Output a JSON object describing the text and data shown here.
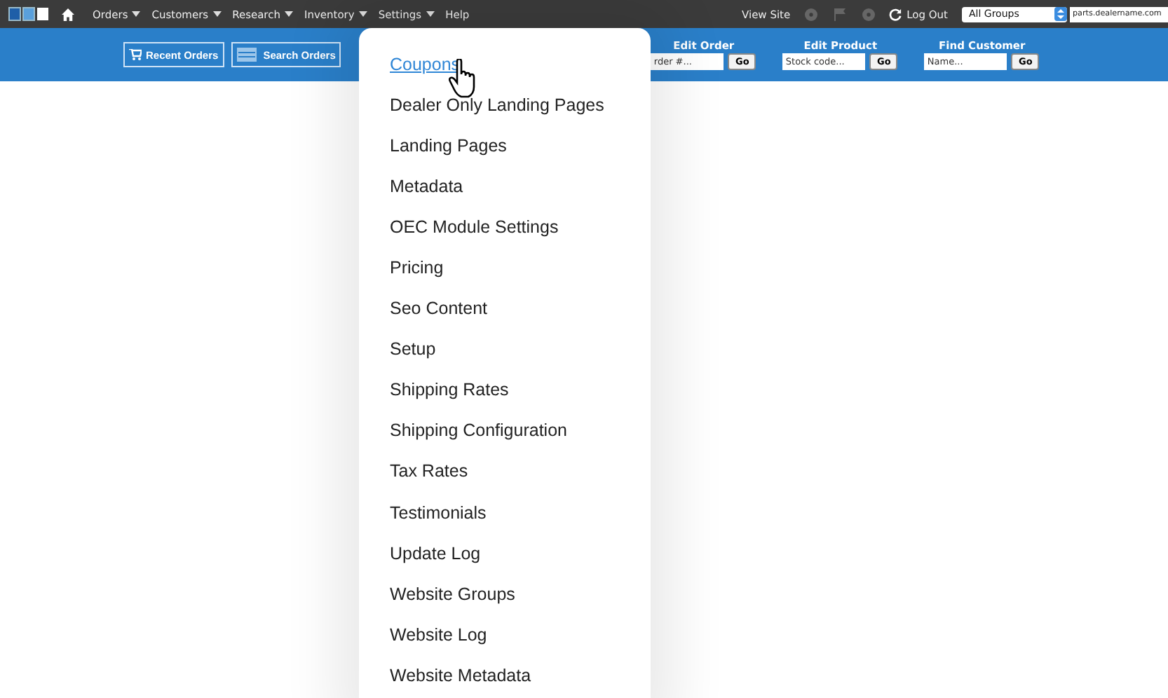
{
  "top_nav": {
    "items": [
      {
        "label": "Orders",
        "dropdown": true
      },
      {
        "label": "Customers",
        "dropdown": true
      },
      {
        "label": "Research",
        "dropdown": true
      },
      {
        "label": "Inventory",
        "dropdown": true
      },
      {
        "label": "Settings",
        "dropdown": true
      },
      {
        "label": "Help",
        "dropdown": false
      }
    ],
    "view_site": "View Site",
    "log_out": "Log Out",
    "group_select": "All Groups",
    "domain_field": "parts.dealername.com"
  },
  "toolbar": {
    "buttons": [
      "Recent Orders",
      "Search Orders"
    ],
    "lookups": [
      {
        "label": "Edit Order",
        "placeholder": "rder #...",
        "button": "Go"
      },
      {
        "label": "Edit Product",
        "placeholder": "Stock code...",
        "button": "Go"
      },
      {
        "label": "Find Customer",
        "placeholder": "Name...",
        "button": "Go"
      }
    ]
  },
  "settings_menu": {
    "items": [
      {
        "label": "Coupons",
        "selected": true
      },
      {
        "label": "Dealer Only Landing Pages",
        "selected": false
      },
      {
        "label": "Landing Pages",
        "selected": false
      },
      {
        "label": "Metadata",
        "selected": false
      },
      {
        "label": "OEC Module Settings",
        "selected": false
      },
      {
        "label": "Pricing",
        "selected": false
      },
      {
        "label": "Seo Content",
        "selected": false
      },
      {
        "label": "Setup",
        "selected": false
      },
      {
        "label": "Shipping Rates",
        "selected": false
      },
      {
        "label": "Shipping Configuration",
        "selected": false
      },
      {
        "label": "Tax Rates",
        "selected": false
      },
      {
        "label": "Testimonials",
        "selected": false
      },
      {
        "label": "Update Log",
        "selected": false
      },
      {
        "label": "Website Groups",
        "selected": false
      },
      {
        "label": "Website Log",
        "selected": false
      },
      {
        "label": "Website Metadata",
        "selected": false
      }
    ]
  }
}
